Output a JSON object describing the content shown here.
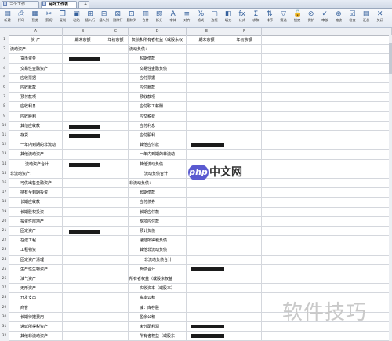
{
  "tabs": [
    {
      "label": "三个工作",
      "active": false
    },
    {
      "label": "另外工作表",
      "active": true
    },
    {
      "label": "+",
      "active": false
    }
  ],
  "toolbar": [
    {
      "name": "new",
      "label": "新建",
      "icon": "▤"
    },
    {
      "name": "print",
      "label": "打印",
      "icon": "⎙"
    },
    {
      "name": "preview",
      "label": "预览",
      "icon": "▦"
    },
    {
      "name": "cut",
      "label": "剪切",
      "icon": "✂"
    },
    {
      "name": "copy",
      "label": "复制",
      "icon": "❐"
    },
    {
      "name": "paste",
      "label": "粘贴",
      "icon": "▣"
    },
    {
      "name": "insert-row",
      "label": "插入行",
      "icon": "⊞"
    },
    {
      "name": "insert-col",
      "label": "插入列",
      "icon": "⊟"
    },
    {
      "name": "delete-row",
      "label": "删除行",
      "icon": "⊠"
    },
    {
      "name": "delete-col",
      "label": "删除列",
      "icon": "⊡"
    },
    {
      "name": "merge",
      "label": "合并",
      "icon": "▥"
    },
    {
      "name": "split",
      "label": "拆分",
      "icon": "▧"
    },
    {
      "name": "font",
      "label": "字体",
      "icon": "A"
    },
    {
      "name": "align",
      "label": "对齐",
      "icon": "≡"
    },
    {
      "name": "format",
      "label": "格式",
      "icon": "%"
    },
    {
      "name": "border",
      "label": "边框",
      "icon": "▢"
    },
    {
      "name": "fill",
      "label": "填充",
      "icon": "◧"
    },
    {
      "name": "formula",
      "label": "公式",
      "icon": "fx"
    },
    {
      "name": "sum",
      "label": "求和",
      "icon": "Σ"
    },
    {
      "name": "sort",
      "label": "排序",
      "icon": "⇅"
    },
    {
      "name": "filter",
      "label": "筛选",
      "icon": "▽"
    },
    {
      "name": "lock",
      "label": "锁定",
      "icon": "🔒"
    },
    {
      "name": "protect",
      "label": "保护",
      "icon": "⊘"
    },
    {
      "name": "audit",
      "label": "审核",
      "icon": "✓"
    },
    {
      "name": "zoom",
      "label": "缩放",
      "icon": "⊕"
    },
    {
      "name": "check",
      "label": "检查",
      "icon": "☑"
    },
    {
      "name": "summary",
      "label": "汇总",
      "icon": "▤"
    },
    {
      "name": "close",
      "label": "关闭",
      "icon": "✕"
    }
  ],
  "columns": [
    "A",
    "B",
    "C",
    "D",
    "E",
    "F"
  ],
  "headers": {
    "a": "资    产",
    "b": "期末余额",
    "c": "年初余额",
    "d": "负债和所有者权益（或股东权",
    "e": "期末余额",
    "f": "年初余额"
  },
  "rows": [
    {
      "n": "1",
      "a": "资    产",
      "d": "负债和所有者权益（或股东权",
      "b": "期末余额",
      "c": "年初余额",
      "e": "期末余额",
      "f": "年初余额",
      "hdr": true
    },
    {
      "n": "2",
      "a": "流动资产：",
      "d": "流动负债：",
      "aInd": 0,
      "dInd": 0
    },
    {
      "n": "3",
      "a": "货币资金",
      "d": "短期借款",
      "aInd": 1,
      "dInd": 1,
      "rb": true
    },
    {
      "n": "4",
      "a": "交易性金融资产",
      "d": "交易性金融负债",
      "aInd": 1,
      "dInd": 1
    },
    {
      "n": "5",
      "a": "应收票据",
      "d": "应付票据",
      "aInd": 1,
      "dInd": 1
    },
    {
      "n": "6",
      "a": "应收账款",
      "d": "应付账款",
      "aInd": 1,
      "dInd": 1
    },
    {
      "n": "7",
      "a": "预付款项",
      "d": "预收款项",
      "aInd": 1,
      "dInd": 1
    },
    {
      "n": "8",
      "a": "应收利息",
      "d": "应付职工薪酬",
      "aInd": 1,
      "dInd": 1
    },
    {
      "n": "9",
      "a": "应收股利",
      "d": "应交税费",
      "aInd": 1,
      "dInd": 1
    },
    {
      "n": "10",
      "a": "其他应收款",
      "d": "应付利息",
      "aInd": 1,
      "dInd": 1,
      "rb": true
    },
    {
      "n": "11",
      "a": "存货",
      "d": "应付股利",
      "aInd": 1,
      "dInd": 1,
      "rb": true
    },
    {
      "n": "12",
      "a": "一年内到期的非流动",
      "d": "其他应付款",
      "aInd": 1,
      "dInd": 1,
      "re": true
    },
    {
      "n": "13",
      "a": "其他流动资产",
      "d": "一年内到期的非流动",
      "aInd": 1,
      "dInd": 1
    },
    {
      "n": "14",
      "a": "流动资产合计",
      "d": "其他流动负债",
      "aInd": 2,
      "dInd": 1,
      "rb": true
    },
    {
      "n": "15",
      "a": "非流动资产：",
      "d": "流动负债合计",
      "aInd": 0,
      "dInd": 2
    },
    {
      "n": "16",
      "a": "可供出售金融资产",
      "d": "非流动负债：",
      "aInd": 1,
      "dInd": 0
    },
    {
      "n": "17",
      "a": "持有至到期投资",
      "d": "长期借款",
      "aInd": 1,
      "dInd": 1
    },
    {
      "n": "18",
      "a": "长期应收款",
      "d": "应付债券",
      "aInd": 1,
      "dInd": 1
    },
    {
      "n": "19",
      "a": "长期股权投资",
      "d": "长期应付款",
      "aInd": 1,
      "dInd": 1
    },
    {
      "n": "20",
      "a": "投资性房地产",
      "d": "专项应付款",
      "aInd": 1,
      "dInd": 1
    },
    {
      "n": "21",
      "a": "固定资产",
      "d": "预计负债",
      "aInd": 1,
      "dInd": 1,
      "rb": true
    },
    {
      "n": "22",
      "a": "在建工程",
      "d": "递延所得税负债",
      "aInd": 1,
      "dInd": 1
    },
    {
      "n": "23",
      "a": "工程物资",
      "d": "其他非流动负债",
      "aInd": 1,
      "dInd": 1
    },
    {
      "n": "24",
      "a": "固定资产清理",
      "d": "非流动负债合计",
      "aInd": 1,
      "dInd": 2
    },
    {
      "n": "25",
      "a": "生产性生物资产",
      "d": "负债合计",
      "aInd": 1,
      "dInd": 1,
      "re": true
    },
    {
      "n": "26",
      "a": "油气资产",
      "d": "所有者权益（或股东权益",
      "aInd": 1,
      "dInd": 0
    },
    {
      "n": "27",
      "a": "无形资产",
      "d": "实收资本（或股本）",
      "aInd": 1,
      "dInd": 1
    },
    {
      "n": "28",
      "a": "开发支出",
      "d": "资本公积",
      "aInd": 1,
      "dInd": 1
    },
    {
      "n": "29",
      "a": "商誉",
      "d": "减：库存股",
      "aInd": 1,
      "dInd": 1
    },
    {
      "n": "30",
      "a": "长期待摊费用",
      "d": "盈余公积",
      "aInd": 1,
      "dInd": 1
    },
    {
      "n": "31",
      "a": "递延所得税资产",
      "d": "未分配利润",
      "aInd": 1,
      "dInd": 1,
      "re": true
    },
    {
      "n": "32",
      "a": "其他非流动资产",
      "d": "所有者权益（或股东",
      "aInd": 1,
      "dInd": 1,
      "re": true
    }
  ],
  "watermark_center": {
    "pill": "php",
    "text": "中文网"
  },
  "watermark_corner": {
    "text": "软件技巧"
  }
}
